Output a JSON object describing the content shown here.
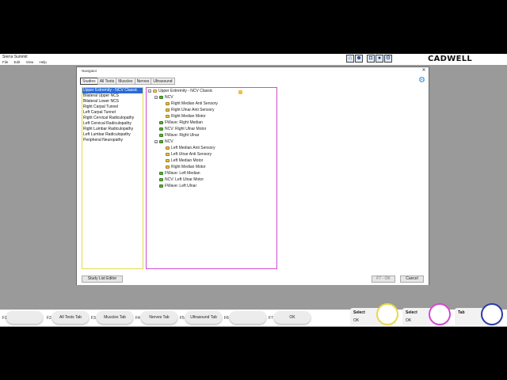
{
  "app": {
    "title": "Sierra Summit",
    "menu": [
      "File",
      "Edit",
      "View",
      "Help"
    ],
    "brand": "CADWELL",
    "toolbar_icons": [
      "home-icon",
      "user-icon",
      "camera-icon",
      "record-icon",
      "settings-icon"
    ]
  },
  "navigator": {
    "title": "Navigator",
    "tabs": [
      "Studies",
      "All Tests",
      "Muscles",
      "Nerves",
      "Ultrasound"
    ],
    "active_tab": "Studies",
    "studies": [
      "Upper Extremity - NCV Classic",
      "Bilateral Upper NCS",
      "Bilateral Lower NCS",
      "Right Carpal Tunnel",
      "Left Carpal Tunnel",
      "Right Cervical Radiculopathy",
      "Left Cervical Radiculopathy",
      "Right Lumbar Radiculopathy",
      "Left Lumbar Radiculopathy",
      "Peripheral Neuropathy"
    ],
    "selected_study": "Upper Extremity - NCV Classic",
    "tree": [
      {
        "label": "Upper Extremity - NCV Classic",
        "level": 0,
        "icon": "folder",
        "expander": "−"
      },
      {
        "label": "NCV",
        "level": 1,
        "icon": "green",
        "expander": "−"
      },
      {
        "label": "Right Median Anti Sensory",
        "level": 2,
        "icon": "yellow",
        "expander": ""
      },
      {
        "label": "Right Ulnar Anti Sensory",
        "level": 2,
        "icon": "yellow",
        "expander": ""
      },
      {
        "label": "Right Median Motor",
        "level": 2,
        "icon": "yellow",
        "expander": ""
      },
      {
        "label": "FWave: Right Median",
        "level": 1,
        "icon": "green",
        "expander": ""
      },
      {
        "label": "NCV: Right Ulnar Motor",
        "level": 1,
        "icon": "green",
        "expander": ""
      },
      {
        "label": "FWave: Right Ulnar",
        "level": 1,
        "icon": "green",
        "expander": ""
      },
      {
        "label": "NCV",
        "level": 1,
        "icon": "green",
        "expander": "−"
      },
      {
        "label": "Left Median Anti Sensory",
        "level": 2,
        "icon": "yellow",
        "expander": ""
      },
      {
        "label": "Left Ulnar Anti Sensory",
        "level": 2,
        "icon": "yellow",
        "expander": ""
      },
      {
        "label": "Left Median Motor",
        "level": 2,
        "icon": "yellow",
        "expander": ""
      },
      {
        "label": "Right Median Motor",
        "level": 2,
        "icon": "yellow",
        "expander": ""
      },
      {
        "label": "FWave: Left Median",
        "level": 1,
        "icon": "green",
        "expander": ""
      },
      {
        "label": "NCV: Left Ulnar Motor",
        "level": 1,
        "icon": "green",
        "expander": ""
      },
      {
        "label": "FWave: Left Ulnar",
        "level": 1,
        "icon": "green",
        "expander": ""
      }
    ],
    "buttons": {
      "study_list_editor": "Study List Editor",
      "f7_ok": "F7 - OK",
      "cancel": "Cancel"
    }
  },
  "function_keys": [
    {
      "key": "F1",
      "label": ""
    },
    {
      "key": "F2",
      "label": "All Tests Tab"
    },
    {
      "key": "F3",
      "label": "Muscles Tab"
    },
    {
      "key": "F4",
      "label": "Nerves Tab"
    },
    {
      "key": "F5",
      "label": "Ultrasound Tab"
    },
    {
      "key": "F6",
      "label": ""
    },
    {
      "key": "F7",
      "label": "OK"
    }
  ],
  "knobs": [
    {
      "label": "Select",
      "value": "OK",
      "ring_color": "#e8d84a"
    },
    {
      "label": "Select",
      "value": "OK",
      "ring_color": "#d24ad2"
    },
    {
      "label": "Tab",
      "value": "",
      "ring_color": "#2a3aa8"
    }
  ],
  "colors": {
    "study_list_border": "#e6d94a",
    "tree_border": "#d24ad2",
    "selection": "#2a6ad6"
  }
}
